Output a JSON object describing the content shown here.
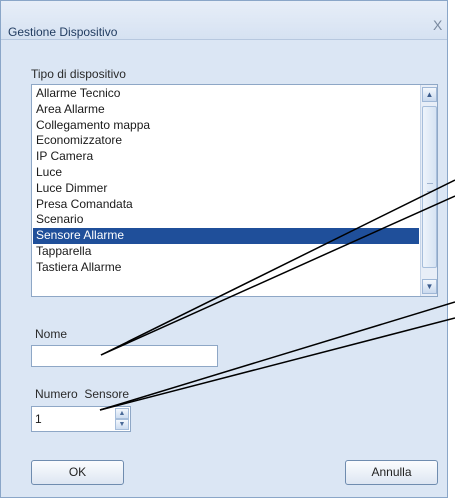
{
  "dialog": {
    "title": "Gestione Dispositivo",
    "close_glyph": "X"
  },
  "device_type": {
    "label": "Tipo di dispositivo",
    "items": [
      "Allarme Tecnico",
      "Area Allarme",
      "Collegamento mappa",
      "Economizzatore",
      "IP Camera",
      "Luce",
      "Luce Dimmer",
      "Presa Comandata",
      "Scenario",
      "Sensore Allarme",
      "Tapparella",
      "Tastiera Allarme"
    ],
    "selected": "Sensore Allarme"
  },
  "name_field": {
    "label": "Nome",
    "value": ""
  },
  "sensor_number": {
    "label": "Numero  Sensore",
    "value": "1"
  },
  "buttons": {
    "ok": "OK",
    "cancel": "Annulla"
  },
  "icons": {
    "close": "close-icon",
    "scroll_up": "chevron-up-icon",
    "scroll_down": "chevron-down-icon"
  }
}
